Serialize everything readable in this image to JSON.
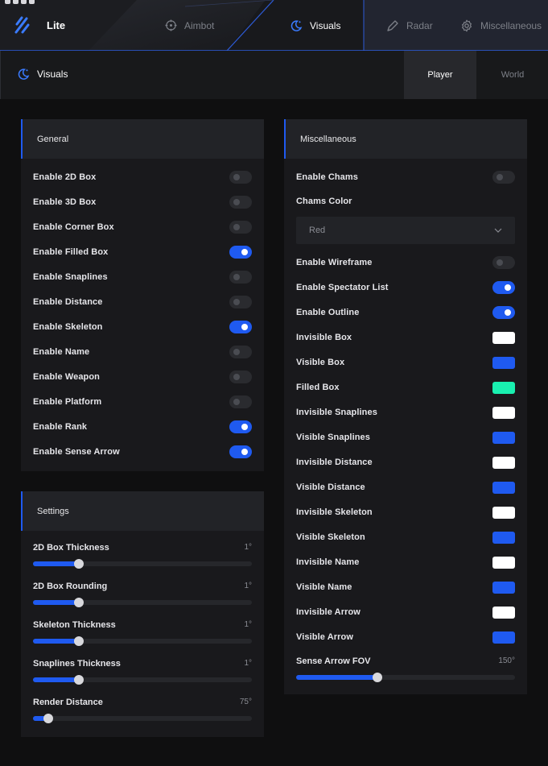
{
  "brand": {
    "label": "Lite"
  },
  "nav": {
    "tabs": [
      {
        "label": "Aimbot",
        "icon": "crosshair-icon"
      },
      {
        "label": "Visuals",
        "icon": "moon-icon",
        "active": true
      },
      {
        "label": "Radar",
        "icon": "pen-icon"
      },
      {
        "label": "Miscellaneous",
        "icon": "gear-icon"
      }
    ]
  },
  "subheader": {
    "title": "Visuals",
    "tabs": [
      {
        "label": "Player",
        "active": true
      },
      {
        "label": "World"
      }
    ]
  },
  "general": {
    "title": "General",
    "toggles": [
      {
        "label": "Enable 2D Box",
        "on": false
      },
      {
        "label": "Enable 3D Box",
        "on": false
      },
      {
        "label": "Enable Corner Box",
        "on": false
      },
      {
        "label": "Enable Filled Box",
        "on": true
      },
      {
        "label": "Enable Snaplines",
        "on": false
      },
      {
        "label": "Enable Distance",
        "on": false
      },
      {
        "label": "Enable Skeleton",
        "on": true
      },
      {
        "label": "Enable Name",
        "on": false
      },
      {
        "label": "Enable Weapon",
        "on": false
      },
      {
        "label": "Enable Platform",
        "on": false
      },
      {
        "label": "Enable Rank",
        "on": true
      },
      {
        "label": "Enable Sense Arrow",
        "on": true
      }
    ]
  },
  "settings": {
    "title": "Settings",
    "sliders": [
      {
        "label": "2D Box Thickness",
        "value": "1°",
        "fraction": 0.21
      },
      {
        "label": "2D Box Rounding",
        "value": "1°",
        "fraction": 0.21
      },
      {
        "label": "Skeleton Thickness",
        "value": "1°",
        "fraction": 0.21
      },
      {
        "label": "Snaplines Thickness",
        "value": "1°",
        "fraction": 0.21
      },
      {
        "label": "Render Distance",
        "value": "75°",
        "fraction": 0.07
      }
    ]
  },
  "misc": {
    "title": "Miscellaneous",
    "enable_chams": {
      "label": "Enable Chams",
      "on": false
    },
    "chams_color": {
      "label": "Chams Color",
      "selected": "Red"
    },
    "toggles": [
      {
        "label": "Enable Wireframe",
        "on": false
      },
      {
        "label": "Enable Spectator List",
        "on": true
      },
      {
        "label": "Enable Outline",
        "on": true
      }
    ],
    "colors": [
      {
        "label": "Invisible Box",
        "color": "#ffffff"
      },
      {
        "label": "Visible Box",
        "color": "#1f5af0"
      },
      {
        "label": "Filled Box",
        "color": "#19f0b0"
      },
      {
        "label": "Invisible Snaplines",
        "color": "#ffffff"
      },
      {
        "label": "Visible Snaplines",
        "color": "#1f5af0"
      },
      {
        "label": "Invisible Distance",
        "color": "#ffffff"
      },
      {
        "label": "Visible Distance",
        "color": "#1f5af0"
      },
      {
        "label": "Invisible Skeleton",
        "color": "#ffffff"
      },
      {
        "label": "Visible Skeleton",
        "color": "#1f5af0"
      },
      {
        "label": "Invisible Name",
        "color": "#ffffff"
      },
      {
        "label": "Visible Name",
        "color": "#1f5af0"
      },
      {
        "label": "Invisible Arrow",
        "color": "#ffffff"
      },
      {
        "label": "Visible Arrow",
        "color": "#1f5af0"
      }
    ],
    "fov_slider": {
      "label": "Sense Arrow FOV",
      "value": "150°",
      "fraction": 0.37
    }
  }
}
